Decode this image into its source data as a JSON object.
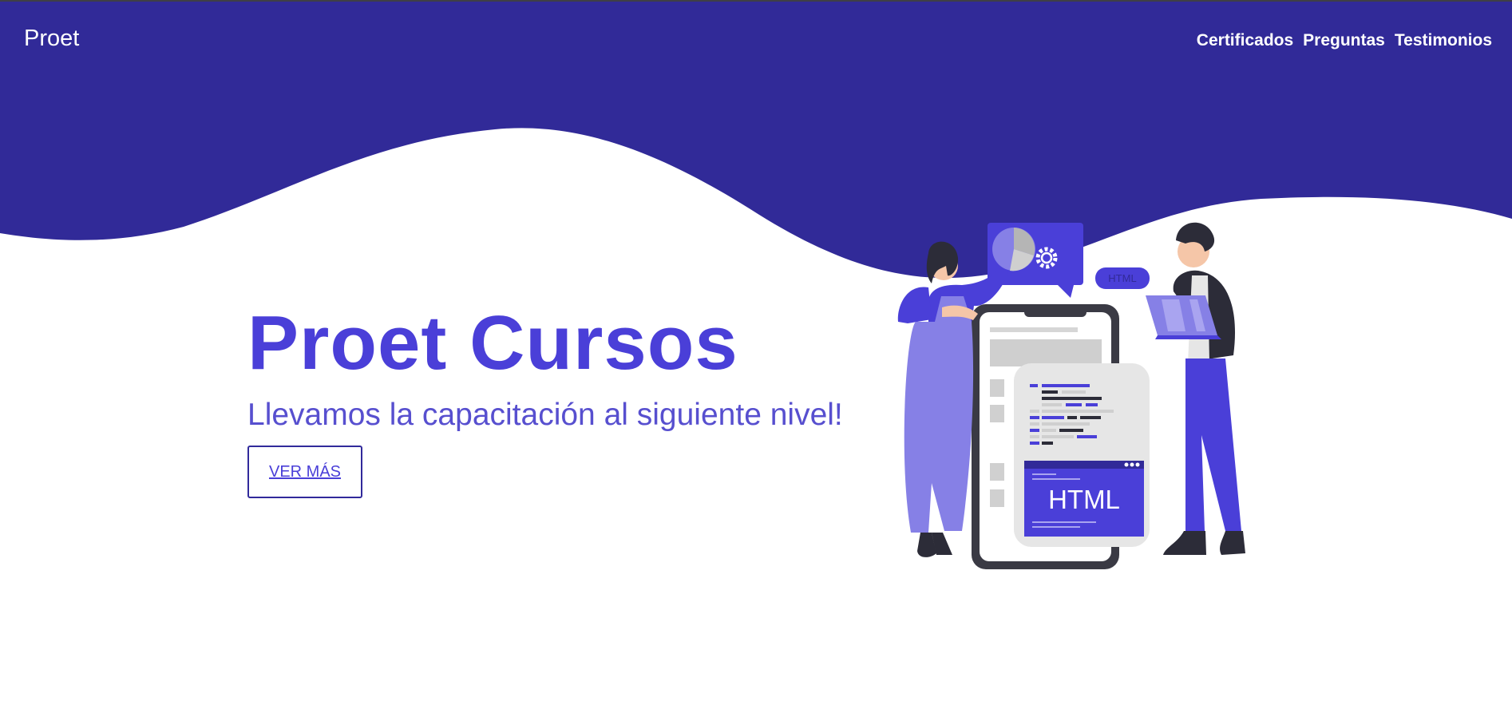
{
  "navbar": {
    "brand": "Proet",
    "links": [
      "Certificados",
      "Preguntas",
      "Testimonios"
    ]
  },
  "hero": {
    "title": "Proet Cursos",
    "subtitle": "Llevamos la capacitación al siguiente nivel!",
    "button_label": "VER MÁS"
  },
  "illustration": {
    "bubble_label": "HTML",
    "panel_label": "HTML"
  },
  "colors": {
    "header_bg": "#312a98",
    "accent": "#4a3fd8",
    "accent_light": "#8680e6",
    "dark": "#2c2c38"
  }
}
